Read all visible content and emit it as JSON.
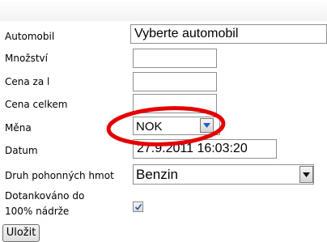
{
  "form": {
    "automobil": {
      "label": "Automobil",
      "value": "Vyberte automobil"
    },
    "mnozstvi": {
      "label": "Množství",
      "value": ""
    },
    "cena_za_l": {
      "label": "Cena za l",
      "value": ""
    },
    "cena_celkem": {
      "label": "Cena celkem",
      "value": ""
    },
    "mena": {
      "label": "Měna",
      "value": "NOK"
    },
    "datum": {
      "label": "Datum",
      "value": "27.9.2011 16:03:20"
    },
    "druh": {
      "label": "Druh pohonných hmot",
      "value": "Benzin"
    },
    "dotankovano": {
      "label_line1": "Dotankováno do",
      "label_line2": "100% nádrže",
      "checked": true
    },
    "save_label": "Uložit"
  },
  "colors": {
    "annotation_circle": "#e50000",
    "checkmark": "#2a4fb0",
    "dropdown_arrow_active": "#1f5fbf"
  }
}
